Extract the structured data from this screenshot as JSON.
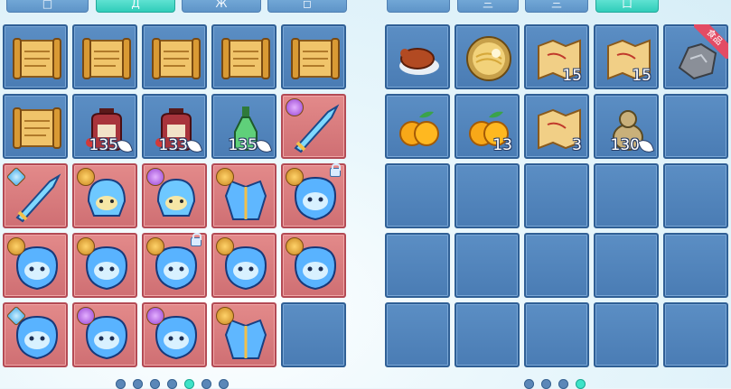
{
  "left_tabs": [
    {
      "label": "□",
      "active": false
    },
    {
      "label": "Д",
      "active": true
    },
    {
      "label": "Ж",
      "active": false
    },
    {
      "label": "◻",
      "active": false
    }
  ],
  "right_tabs": [
    {
      "label": "",
      "active": false
    },
    {
      "label": "三",
      "active": false
    },
    {
      "label": "三",
      "active": false
    },
    {
      "label": "口",
      "active": true
    }
  ],
  "left_grid": {
    "rows": [
      [
        {
          "item": "scroll",
          "icon": "scroll-icon"
        },
        {
          "item": "scroll",
          "icon": "scroll-icon"
        },
        {
          "item": "scroll",
          "icon": "scroll-icon"
        },
        {
          "item": "scroll",
          "icon": "scroll-icon"
        },
        {
          "item": "scroll",
          "icon": "scroll-icon"
        }
      ],
      [
        {
          "item": "scroll",
          "icon": "scroll-icon"
        },
        {
          "item": "red-jar",
          "icon": "potion-jar-icon",
          "count": "135"
        },
        {
          "item": "red-jar",
          "icon": "potion-jar-icon",
          "count": "133"
        },
        {
          "item": "green-bottle",
          "icon": "green-bottle-icon",
          "count": "135"
        },
        {
          "item": "blue-blade",
          "icon": "blade-icon",
          "red": true,
          "badge": "purple"
        }
      ],
      [
        {
          "item": "blue-blade",
          "icon": "blade-icon",
          "red": true,
          "badge": "blue"
        },
        {
          "item": "blue-helmet",
          "icon": "helmet-icon",
          "red": true,
          "badge": "gold"
        },
        {
          "item": "blue-helmet",
          "icon": "helmet-icon",
          "red": true,
          "badge": "purple"
        },
        {
          "item": "blue-armor",
          "icon": "armor-icon",
          "red": true,
          "badge": "gold"
        },
        {
          "item": "blue-mask",
          "icon": "mask-icon",
          "red": true,
          "badge": "gold",
          "lock": true
        }
      ],
      [
        {
          "item": "blue-mask",
          "icon": "mask-icon",
          "red": true,
          "badge": "gold"
        },
        {
          "item": "blue-mask",
          "icon": "mask-icon",
          "red": true,
          "badge": "gold"
        },
        {
          "item": "blue-mask",
          "icon": "mask-icon",
          "red": true,
          "badge": "gold",
          "lock": true
        },
        {
          "item": "blue-mask",
          "icon": "mask-icon",
          "red": true,
          "badge": "gold"
        },
        {
          "item": "blue-mask",
          "icon": "mask-icon",
          "red": true,
          "badge": "gold"
        }
      ],
      [
        {
          "item": "blue-mask",
          "icon": "mask-icon",
          "red": true,
          "badge": "blue"
        },
        {
          "item": "blue-mask",
          "icon": "mask-icon",
          "red": true,
          "badge": "purple"
        },
        {
          "item": "blue-mask",
          "icon": "mask-icon",
          "red": true,
          "badge": "purple"
        },
        {
          "item": "blue-armor",
          "icon": "armor-icon",
          "red": true,
          "badge": "gold"
        },
        {
          "item": "empty"
        }
      ]
    ]
  },
  "right_grid": {
    "rows": [
      [
        {
          "item": "roast-duck",
          "icon": "roast-duck-icon"
        },
        {
          "item": "noodle-bowl",
          "icon": "noodle-bowl-icon"
        },
        {
          "item": "map",
          "icon": "map-icon",
          "count": "15"
        },
        {
          "item": "map",
          "icon": "map-icon",
          "count": "15"
        },
        {
          "item": "ore",
          "icon": "ore-icon",
          "ribbon": "食品"
        }
      ],
      [
        {
          "item": "oranges",
          "icon": "orange-icon"
        },
        {
          "item": "oranges",
          "icon": "orange-icon",
          "count": "13"
        },
        {
          "item": "map",
          "icon": "map-icon",
          "count": "3"
        },
        {
          "item": "gourd",
          "icon": "gourd-icon",
          "count": "130",
          "leaf": true
        },
        {
          "item": "empty"
        }
      ],
      [
        {
          "item": "empty"
        },
        {
          "item": "empty"
        },
        {
          "item": "empty"
        },
        {
          "item": "empty"
        },
        {
          "item": "empty"
        }
      ],
      [
        {
          "item": "empty"
        },
        {
          "item": "empty"
        },
        {
          "item": "empty"
        },
        {
          "item": "empty"
        },
        {
          "item": "empty"
        }
      ],
      [
        {
          "item": "empty"
        },
        {
          "item": "empty"
        },
        {
          "item": "empty"
        },
        {
          "item": "empty"
        },
        {
          "item": "empty"
        }
      ]
    ]
  },
  "left_pager": {
    "pages": 7,
    "active": 5
  },
  "right_pager": {
    "pages": 4,
    "active": 4
  },
  "colors": {
    "slot_blue": "#4a7cb4",
    "slot_red": "#cf6f73",
    "accent_teal": "#30cdb9"
  }
}
